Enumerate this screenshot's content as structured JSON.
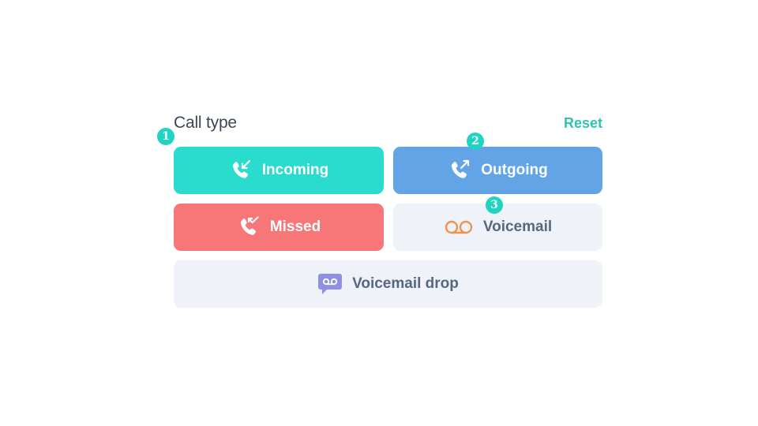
{
  "panel": {
    "title": "Call type",
    "reset_label": "Reset"
  },
  "options": {
    "incoming": {
      "label": "Incoming",
      "icon": "incoming-call-icon",
      "color": "#29dccd"
    },
    "outgoing": {
      "label": "Outgoing",
      "icon": "outgoing-call-icon",
      "color": "#63a4e6"
    },
    "missed": {
      "label": "Missed",
      "icon": "missed-call-icon",
      "color": "#f77677"
    },
    "voicemail": {
      "label": "Voicemail",
      "icon": "voicemail-icon",
      "color": "#f0934a"
    },
    "voicemail_drop": {
      "label": "Voicemail drop",
      "icon": "voicemail-drop-icon",
      "color": "#8f8fe6"
    }
  },
  "markers": [
    "1",
    "2",
    "3"
  ],
  "colors": {
    "accent": "#2dc5b0",
    "inactive_bg": "#eff2f9",
    "marker": "#1fd4c2"
  }
}
